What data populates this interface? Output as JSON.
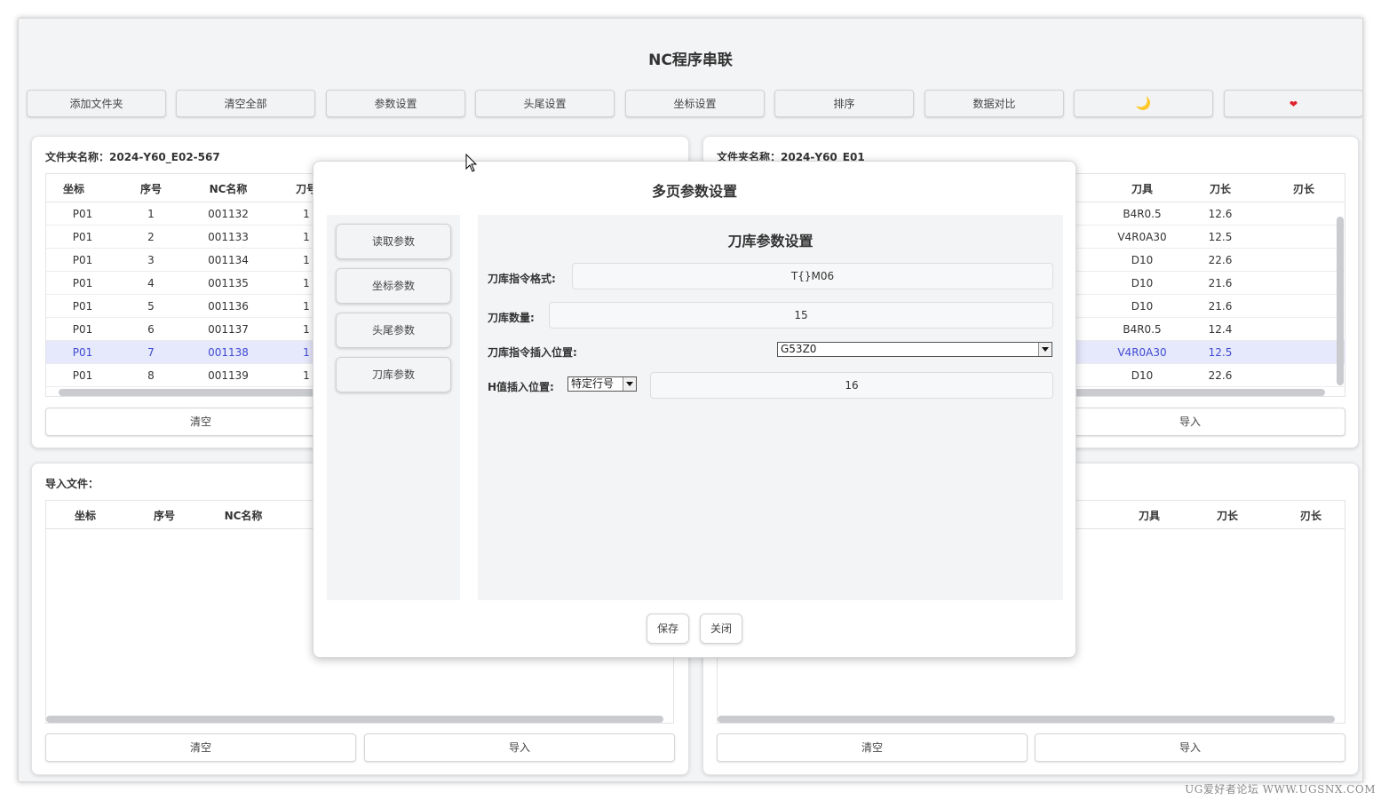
{
  "app": {
    "title": "NC程序串联"
  },
  "toolbar": {
    "add_folder": "添加文件夹",
    "clear_all": "清空全部",
    "param_settings": "参数设置",
    "head_tail_settings": "头尾设置",
    "coord_settings": "坐标设置",
    "sort": "排序",
    "data_compare": "数据对比",
    "theme_icon": "🌙",
    "heart_icon": "❤"
  },
  "panel_tl": {
    "label": "文件夹名称：2024-Y60_E02-567",
    "headers": [
      "坐标",
      "序号",
      "NC名称",
      "刀号"
    ],
    "rows": [
      [
        "P01",
        "1",
        "001132",
        "1"
      ],
      [
        "P01",
        "2",
        "001133",
        "1"
      ],
      [
        "P01",
        "3",
        "001134",
        "1"
      ],
      [
        "P01",
        "4",
        "001135",
        "1"
      ],
      [
        "P01",
        "5",
        "001136",
        "1"
      ],
      [
        "P01",
        "6",
        "001137",
        "1"
      ],
      [
        "P01",
        "7",
        "001138",
        "1"
      ],
      [
        "P01",
        "8",
        "001139",
        "1"
      ]
    ],
    "selected_row": 6,
    "clear_label": "清空"
  },
  "panel_tr": {
    "label": "文件夹名称：2024-Y60_E01",
    "headers": [
      "刀具",
      "刀长",
      "刃长"
    ],
    "rows": [
      [
        "B4R0.5",
        "12.6",
        ""
      ],
      [
        "V4R0A30",
        "12.5",
        ""
      ],
      [
        "D10",
        "22.6",
        ""
      ],
      [
        "D10",
        "21.6",
        ""
      ],
      [
        "D10",
        "21.6",
        ""
      ],
      [
        "B4R0.5",
        "12.4",
        ""
      ],
      [
        "V4R0A30",
        "12.5",
        ""
      ],
      [
        "D10",
        "22.6",
        ""
      ]
    ],
    "import_label": "导入"
  },
  "panel_bl": {
    "label": "导入文件：",
    "headers": [
      "坐标",
      "序号",
      "NC名称"
    ],
    "clear_label": "清空",
    "import_label": "导入"
  },
  "panel_br": {
    "headers": [
      "刀具",
      "刀长",
      "刃长"
    ],
    "clear_label": "清空",
    "import_label": "导入"
  },
  "modal": {
    "title": "多页参数设置",
    "tabs": [
      "读取参数",
      "坐标参数",
      "头尾参数",
      "刀库参数"
    ],
    "section_title": "刀库参数设置",
    "fields": {
      "cmd_format_label": "刀库指令格式:",
      "cmd_format_value": "T{}M06",
      "count_label": "刀库数量:",
      "count_value": "15",
      "insert_pos_label": "刀库指令插入位置:",
      "insert_pos_value": "G53Z0",
      "h_insert_label": "H值插入位置:",
      "h_insert_mode": "特定行号",
      "h_insert_value": "16"
    },
    "save_label": "保存",
    "close_label": "关闭"
  },
  "watermark": "UG爱好者论坛 WWW.UGSNX.COM"
}
